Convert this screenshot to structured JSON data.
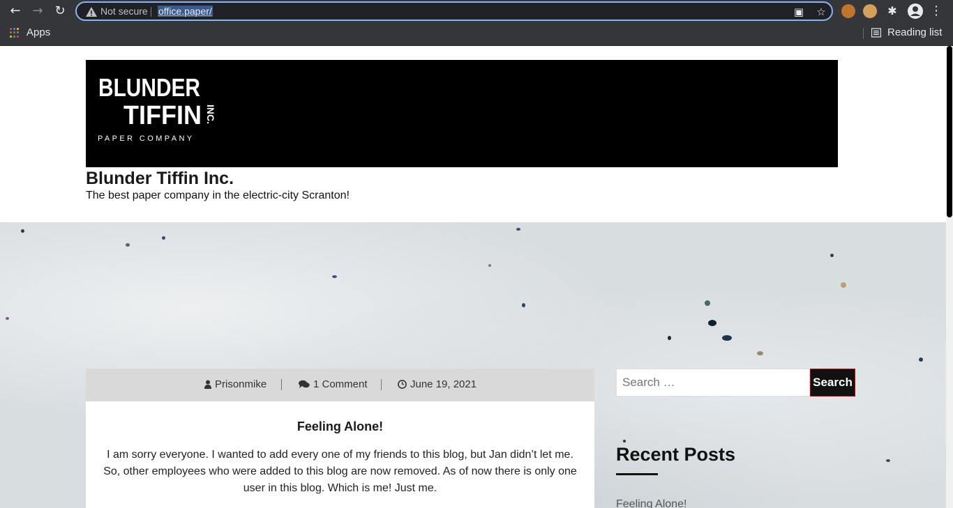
{
  "browser": {
    "security_label": "Not secure",
    "url": "office.paper/",
    "bookmarks": {
      "apps_label": "Apps",
      "reading_list_label": "Reading list"
    }
  },
  "site": {
    "logo": {
      "line1": "BLUNDER",
      "line2": "TIFFIN",
      "inc": "INC.",
      "line3": "PAPER COMPANY"
    },
    "title": "Blunder Tiffin Inc.",
    "tagline": "The best paper company in the electric-city Scranton!"
  },
  "post": {
    "author": "Prisonmike",
    "comments": "1 Comment",
    "date": "June 19, 2021",
    "title": "Feeling Alone!",
    "body": "I am sorry everyone. I wanted to add every one of my friends to this blog, but Jan didn’t let me. So, other employees who were added to this blog are now removed. As of now there is only one user in this blog. Which is me! Just me."
  },
  "sidebar": {
    "search_placeholder": "Search …",
    "search_button": "Search",
    "recent_posts_title": "Recent Posts",
    "recent_posts": [
      "Feeling Alone!"
    ]
  },
  "colors": {
    "accent_focus": "#8ab4f8",
    "search_button_border": "#cc0000",
    "chrome_bg": "#35363a"
  }
}
